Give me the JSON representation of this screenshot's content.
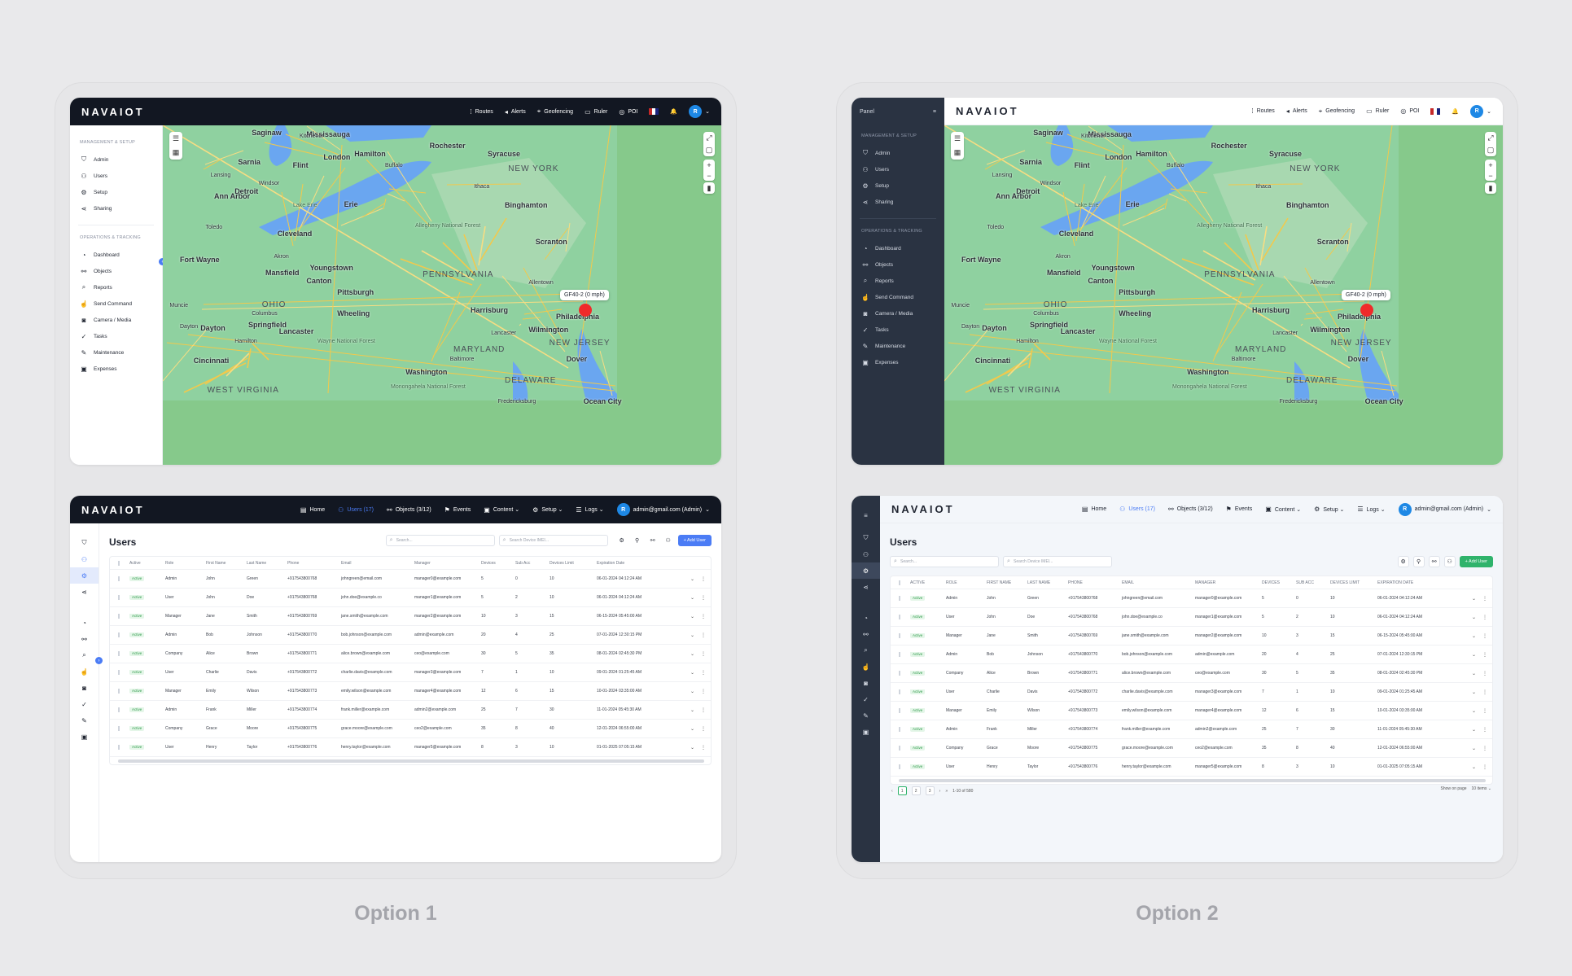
{
  "app": {
    "logo": "NAVAIOT"
  },
  "map_nav": [
    {
      "icon": "routes-icon",
      "glyph": "⁞",
      "label": "Routes"
    },
    {
      "icon": "alerts-icon",
      "glyph": "◂",
      "label": "Alerts"
    },
    {
      "icon": "geofencing-icon",
      "glyph": "⌖",
      "label": "Geofencing"
    },
    {
      "icon": "ruler-icon",
      "glyph": "▭",
      "label": "Ruler"
    },
    {
      "icon": "poi-icon",
      "glyph": "◎",
      "label": "POI"
    }
  ],
  "users_nav": [
    {
      "icon": "home-icon",
      "glyph": "▤",
      "label": "Home"
    },
    {
      "icon": "users-icon",
      "glyph": "⚇",
      "label": "Users (17)",
      "active": true
    },
    {
      "icon": "objects-icon",
      "glyph": "⚯",
      "label": "Objects (3/12)"
    },
    {
      "icon": "events-icon",
      "glyph": "⚑",
      "label": "Events"
    },
    {
      "icon": "content-icon",
      "glyph": "▣",
      "label": "Content ⌄"
    },
    {
      "icon": "setup-icon",
      "glyph": "⚙",
      "label": "Setup ⌄"
    },
    {
      "icon": "logs-icon",
      "glyph": "☰",
      "label": "Logs ⌄"
    }
  ],
  "user_account": {
    "avatar": "R",
    "label": "admin@gmail.com (Admin)"
  },
  "panel": {
    "title": "Panel"
  },
  "sidebar": {
    "sections": [
      {
        "title": "MANAGEMENT & SETUP",
        "items": [
          {
            "icon": "admin-icon",
            "glyph": "⛉",
            "label": "Admin"
          },
          {
            "icon": "users-icon",
            "glyph": "⚇",
            "label": "Users"
          },
          {
            "icon": "setup-icon",
            "glyph": "⚙",
            "label": "Setup"
          },
          {
            "icon": "sharing-icon",
            "glyph": "⋖",
            "label": "Sharing"
          }
        ]
      },
      {
        "title": "OPERATIONS & TRACKING",
        "items": [
          {
            "icon": "dashboard-icon",
            "glyph": "◔",
            "label": "Dashboard"
          },
          {
            "icon": "objects-icon",
            "glyph": "⚯",
            "label": "Objects"
          },
          {
            "icon": "reports-icon",
            "glyph": "⌕",
            "label": "Reports"
          },
          {
            "icon": "send-command-icon",
            "glyph": "☝",
            "label": "Send Command"
          },
          {
            "icon": "camera-icon",
            "glyph": "◙",
            "label": "Camera / Media"
          },
          {
            "icon": "tasks-icon",
            "glyph": "✓",
            "label": "Tasks"
          },
          {
            "icon": "maintenance-icon",
            "glyph": "✎",
            "label": "Maintenance"
          },
          {
            "icon": "expenses-icon",
            "glyph": "▣",
            "label": "Expenses"
          }
        ]
      }
    ]
  },
  "map": {
    "marker_label": "GF40-2 (0 mph)",
    "zoom_in": "+",
    "zoom_out": "−",
    "cities": [
      "Mississauga",
      "Hamilton",
      "Kitchener",
      "London",
      "Sarnia",
      "Lansing",
      "Detroit",
      "Ann Arbor",
      "Toledo",
      "Fort Wayne",
      "Cleveland",
      "Akron",
      "Youngstown",
      "Erie",
      "Buffalo",
      "Rochester",
      "Syracuse",
      "Ithaca",
      "Binghamton",
      "Scranton",
      "Allentown",
      "Philadelphia",
      "Pittsburgh",
      "Columbus",
      "Dayton",
      "Cincinnati",
      "Baltimore",
      "Washington",
      "Wilmington",
      "Lancaster",
      "Harrisburg",
      "Wheeling",
      "Muncie",
      "Saginaw",
      "Flint",
      "Windsor",
      "Dover",
      "Ocean City",
      "Fredericksburg",
      "Mansfield",
      "Canton",
      "Hamilton",
      "Springfield",
      "Lancaster",
      "Dayton"
    ],
    "states": [
      "OHIO",
      "PENNSYLVANIA",
      "NEW YORK",
      "MARYLAND",
      "NEW JERSEY",
      "WEST VIRGINIA",
      "DELAWARE"
    ],
    "labels": [
      "Lake Erie",
      "Allegheny National Forest",
      "Wayne National Forest",
      "Monongahela National Forest"
    ]
  },
  "users_page": {
    "title": "Users",
    "search_placeholder": "Search...",
    "imei_placeholder": "Search Device IMEI...",
    "add_button": "+ Add User",
    "columns": [
      "Active",
      "Role",
      "First Name",
      "Last Name",
      "Phone",
      "Email",
      "Manager",
      "Devices",
      "Sub Acc",
      "Devices Limit",
      "Expiration Date"
    ],
    "columns_upper": [
      "ACTIVE",
      "ROLE",
      "FIRST NAME",
      "LAST NAME",
      "PHONE",
      "EMAIL",
      "MANAGER",
      "DEVICES",
      "SUB ACC",
      "DEVICES LIMIT",
      "EXPIRATION DATE"
    ],
    "rows": [
      [
        "Active",
        "Admin",
        "John",
        "Green",
        "+917543800768",
        "johngreen@email.com",
        "manager0@example.com",
        "5",
        "0",
        "10",
        "06-01-2024 04:12:24 AM"
      ],
      [
        "Active",
        "User",
        "John",
        "Doe",
        "+917543800768",
        "john.doe@example.co",
        "manager1@example.com",
        "5",
        "2",
        "10",
        "06-01-2024 04:12:24 AM"
      ],
      [
        "Active",
        "Manager",
        "Jane",
        "Smith",
        "+917543800769",
        "jane.smith@example.com",
        "manager2@example.com",
        "10",
        "3",
        "15",
        "06-15-2024 05:45:00 AM"
      ],
      [
        "Active",
        "Admin",
        "Bob",
        "Johnson",
        "+917543800770",
        "bob.johnson@example.com",
        "admin@example.com",
        "20",
        "4",
        "25",
        "07-01-2024 12:30:15 PM"
      ],
      [
        "Active",
        "Company",
        "Alice",
        "Brown",
        "+917543800771",
        "alice.brown@example.com",
        "ceo@example.com",
        "30",
        "5",
        "35",
        "08-01-2024 02:45:30 PM"
      ],
      [
        "Active",
        "User",
        "Charlie",
        "Davis",
        "+917543800772",
        "charlie.davis@example.com",
        "manager3@example.com",
        "7",
        "1",
        "10",
        "09-01-2024 01:25:45 AM"
      ],
      [
        "Active",
        "Manager",
        "Emily",
        "Wilson",
        "+917543800773",
        "emily.wilson@example.com",
        "manager4@example.com",
        "12",
        "6",
        "15",
        "10-01-2024 03:35:00 AM"
      ],
      [
        "Active",
        "Admin",
        "Frank",
        "Miller",
        "+917543800774",
        "frank.miller@example.com",
        "admin2@example.com",
        "25",
        "7",
        "30",
        "11-01-2024 05:45:30 AM"
      ],
      [
        "Active",
        "Company",
        "Grace",
        "Moore",
        "+917543800775",
        "grace.moore@example.com",
        "ceo2@example.com",
        "35",
        "8",
        "40",
        "12-01-2024 06:55:00 AM"
      ],
      [
        "Active",
        "User",
        "Henry",
        "Taylor",
        "+917543800776",
        "henry.taylor@example.com",
        "manager5@example.com",
        "8",
        "3",
        "10",
        "01-01-2025 07:05:15 AM"
      ]
    ],
    "pagination": {
      "pages": [
        "1",
        "2",
        "3"
      ],
      "range": "1-10 of 580",
      "show_label": "Show on page",
      "per_page": "10 items ⌄"
    }
  },
  "options": {
    "option1": "Option 1",
    "option2": "Option 2"
  },
  "colors": {
    "accent": "#4b7cf5",
    "green": "#2fb36b",
    "dark_nav": "#121722",
    "dark_sidebar": "#2a3342",
    "marker": "#f02a2a"
  }
}
